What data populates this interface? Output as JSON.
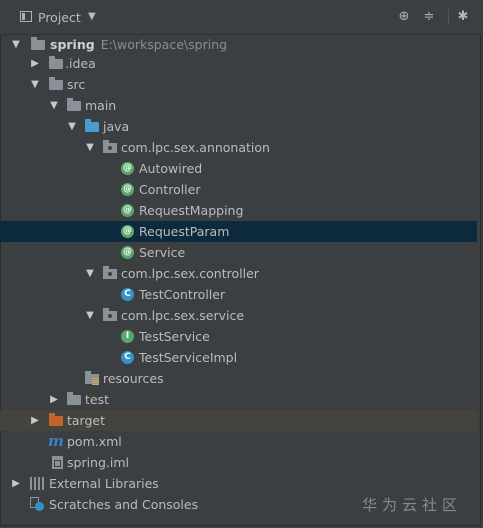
{
  "toolbar": {
    "title": "Project",
    "dropdown_icon": "triangle-down",
    "locate_icon": "crosshair",
    "collapse_icon": "collapse-all",
    "settings_icon": "gear"
  },
  "tree": {
    "spring": {
      "label": "spring",
      "path": "E:\\workspace\\spring"
    },
    "idea": "idea",
    "src": "src",
    "main": "main",
    "java": "java",
    "pkg_annotation": "com.lpc.sex.annonation",
    "autowired": "Autowired",
    "controller": "Controller",
    "requestmapping": "RequestMapping",
    "requestparam": "RequestParam",
    "service": "Service",
    "pkg_controller": "com.lpc.sex.controller",
    "testcontroller": "TestController",
    "pkg_service": "com.lpc.sex.service",
    "testservice": "TestService",
    "testserviceimpl": "TestServiceImpl",
    "resources": "resources",
    "test": "test",
    "target": "target",
    "pom": "pom.xml",
    "iml": "spring.iml",
    "external": "External Libraries",
    "scratches": "Scratches and Consoles"
  },
  "watermark": "华为云社区",
  "colors": {
    "background": "#3c3f41",
    "selected_row": "#0d293e",
    "annotation_icon": "#59a869",
    "class_icon": "#3592c4",
    "source_folder": "#4b9bd1",
    "excluded_folder": "#c5622b"
  }
}
